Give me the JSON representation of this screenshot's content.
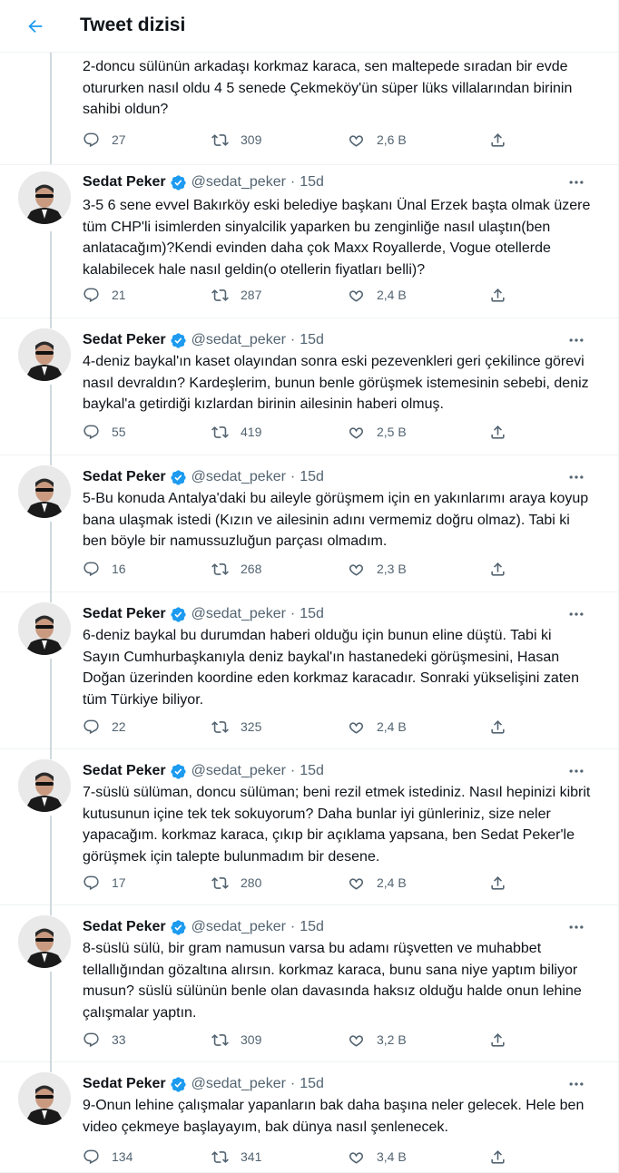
{
  "header": {
    "title": "Tweet dizisi"
  },
  "author": {
    "name": "Sedat Peker",
    "handle": "@sedat_peker",
    "time": "15d"
  },
  "colors": {
    "accent": "#1d9bf0",
    "text": "#0f1419",
    "muted": "#536471",
    "divider": "#eff3f4"
  },
  "icons": {
    "back": "arrow-left-icon",
    "verified": "verified-badge-icon",
    "reply": "reply-icon",
    "retweet": "retweet-icon",
    "like": "heart-icon",
    "share": "share-icon",
    "more": "more-icon"
  },
  "tweets": [
    {
      "text": "2-doncu sülünün arkadaşı korkmaz karaca, sen maltepede sıradan bir evde otururken nasıl oldu 4 5 senede Çekmeköy'ün süper lüks villalarından birinin sahibi oldun?",
      "replies": "27",
      "retweets": "309",
      "likes": "2,6 B"
    },
    {
      "text": "3-5 6 sene evvel Bakırköy eski belediye başkanı Ünal Erzek başta olmak üzere tüm CHP'li isimlerden sinyalcilik yaparken bu zenginliğe nasıl ulaştın(ben anlatacağım)?Kendi evinden daha çok Maxx Royallerde, Vogue otellerde kalabilecek hale nasıl geldin(o otellerin fiyatları belli)?",
      "replies": "21",
      "retweets": "287",
      "likes": "2,4 B"
    },
    {
      "text": "4-deniz baykal'ın kaset olayından sonra eski pezevenkleri geri çekilince görevi nasıl devraldın? Kardeşlerim, bunun benle görüşmek istemesinin sebebi, deniz baykal'a getirdiği kızlardan birinin ailesinin haberi olmuş.",
      "replies": "55",
      "retweets": "419",
      "likes": "2,5 B"
    },
    {
      "text": "5-Bu konuda Antalya'daki bu aileyle görüşmem için en yakınlarımı araya koyup bana ulaşmak istedi (Kızın ve ailesinin adını vermemiz doğru olmaz). Tabi ki ben böyle bir namussuzluğun parçası olmadım.",
      "replies": "16",
      "retweets": "268",
      "likes": "2,3 B"
    },
    {
      "text": "6-deniz baykal bu durumdan haberi olduğu için bunun eline düştü. Tabi ki Sayın Cumhurbaşkanıyla deniz baykal'ın hastanedeki görüşmesini, Hasan Doğan üzerinden koordine eden korkmaz karacadır. Sonraki yükselişini zaten tüm Türkiye biliyor.",
      "replies": "22",
      "retweets": "325",
      "likes": "2,4 B"
    },
    {
      "text": "7-süslü sülüman, doncu sülüman; beni rezil etmek istediniz. Nasıl hepinizi kibrit kutusunun içine tek tek sokuyorum? Daha bunlar iyi günleriniz, size neler yapacağım. korkmaz karaca, çıkıp bir açıklama yapsana, ben Sedat Peker'le görüşmek için talepte bulunmadım bir desene.",
      "replies": "17",
      "retweets": "280",
      "likes": "2,4 B"
    },
    {
      "text": "8-süslü sülü, bir gram namusun varsa bu adamı rüşvetten ve muhabbet tellallığından gözaltına alırsın. korkmaz karaca, bunu sana niye yaptım biliyor musun? süslü sülünün benle olan davasında haksız olduğu halde onun lehine çalışmalar yaptın.",
      "replies": "33",
      "retweets": "309",
      "likes": "3,2 B"
    },
    {
      "text": "9-Onun lehine çalışmalar yapanların bak daha başına neler gelecek. Hele ben video çekmeye başlayayım, bak dünya nasıl şenlenecek.",
      "replies": "134",
      "retweets": "341",
      "likes": "3,4 B"
    }
  ]
}
